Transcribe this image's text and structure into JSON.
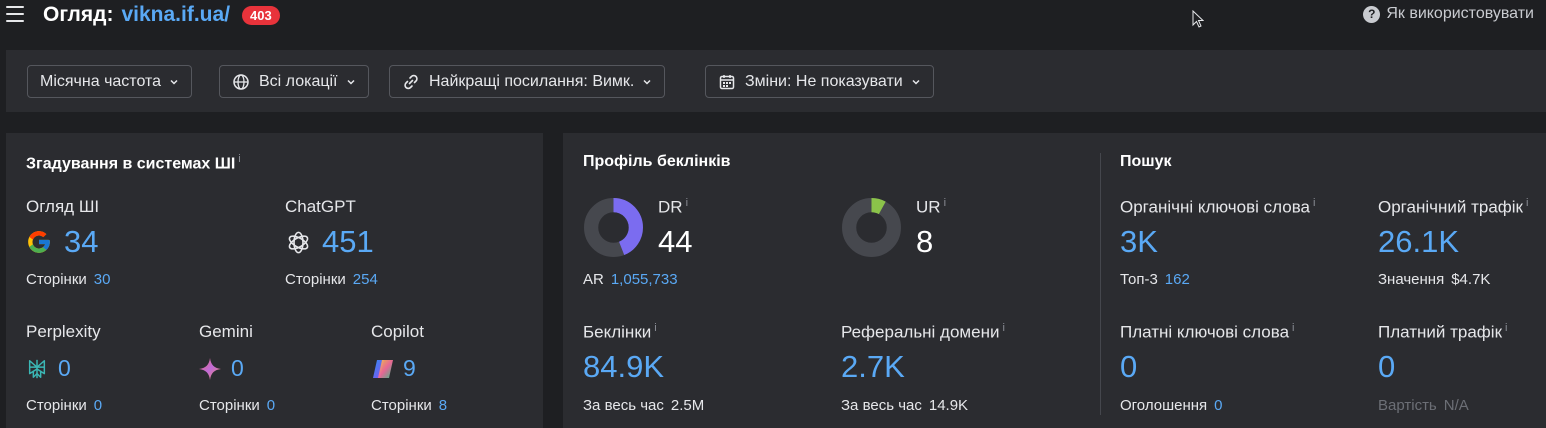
{
  "header": {
    "title_label": "Огляд:",
    "url": "vikna.if.ua/",
    "badge": "403",
    "help_label": "Як використовувати",
    "icons": {
      "menu": "hamburger-icon",
      "help": "question-circle-icon"
    }
  },
  "filters": [
    {
      "label": "Місячна частота",
      "icon": "none"
    },
    {
      "label": "Всі локації",
      "icon": "globe-icon"
    },
    {
      "label": "Найкращі посилання: Вимк.",
      "icon": "link-icon"
    },
    {
      "label": "Зміни: Не показувати",
      "icon": "calendar-icon"
    }
  ],
  "ai": {
    "title": "Згадування в системах ШІ",
    "info": "i",
    "overview": {
      "label": "Огляд ШІ",
      "value": "34",
      "sub_label": "Сторінки",
      "sub_value": "30",
      "icon": "google-icon"
    },
    "chatgpt": {
      "label": "ChatGPT",
      "value": "451",
      "sub_label": "Сторінки",
      "sub_value": "254",
      "icon": "openai-icon"
    },
    "perplexity": {
      "label": "Perplexity",
      "value": "0",
      "sub_label": "Сторінки",
      "sub_value": "0",
      "icon": "perplexity-icon"
    },
    "gemini": {
      "label": "Gemini",
      "value": "0",
      "sub_label": "Сторінки",
      "sub_value": "0",
      "icon": "gemini-icon"
    },
    "copilot": {
      "label": "Copilot",
      "value": "9",
      "sub_label": "Сторінки",
      "sub_value": "8",
      "icon": "copilot-icon"
    }
  },
  "backlinks": {
    "title": "Профіль беклінків",
    "dr": {
      "label": "DR",
      "info": "i",
      "value": "44",
      "fill_percent": 44,
      "color": "#7b6cf0"
    },
    "ar": {
      "label": "AR",
      "value": "1,055,733"
    },
    "ur": {
      "label": "UR",
      "info": "i",
      "value": "8",
      "fill_percent": 8,
      "color": "#8bc34a"
    },
    "backlinks": {
      "label": "Беклінки",
      "info": "i",
      "value": "84.9K",
      "sub_label": "За весь час",
      "sub_value": "2.5M"
    },
    "ref_domains": {
      "label": "Реферальні домени",
      "info": "i",
      "value": "2.7K",
      "sub_label": "За весь час",
      "sub_value": "14.9K"
    }
  },
  "search": {
    "title": "Пошук",
    "organic_kw": {
      "label": "Органічні ключові слова",
      "info": "i",
      "value": "3K",
      "sub_label": "Топ-3",
      "sub_value": "162"
    },
    "organic_traffic": {
      "label": "Органічний трафік",
      "info": "i",
      "value": "26.1K",
      "sub_label": "Значення",
      "sub_value": "$4.7K"
    },
    "paid_kw": {
      "label": "Платні ключові слова",
      "info": "i",
      "value": "0",
      "sub_label": "Оголошення",
      "sub_value": "0"
    },
    "paid_traffic": {
      "label": "Платний трафік",
      "info": "i",
      "value": "0",
      "sub_label": "Вартість",
      "sub_value": "N/A"
    }
  },
  "colors": {
    "accent": "#5aa9f5",
    "badge": "#e8333b",
    "panel": "#2b2c30",
    "background": "#1e1f22"
  }
}
